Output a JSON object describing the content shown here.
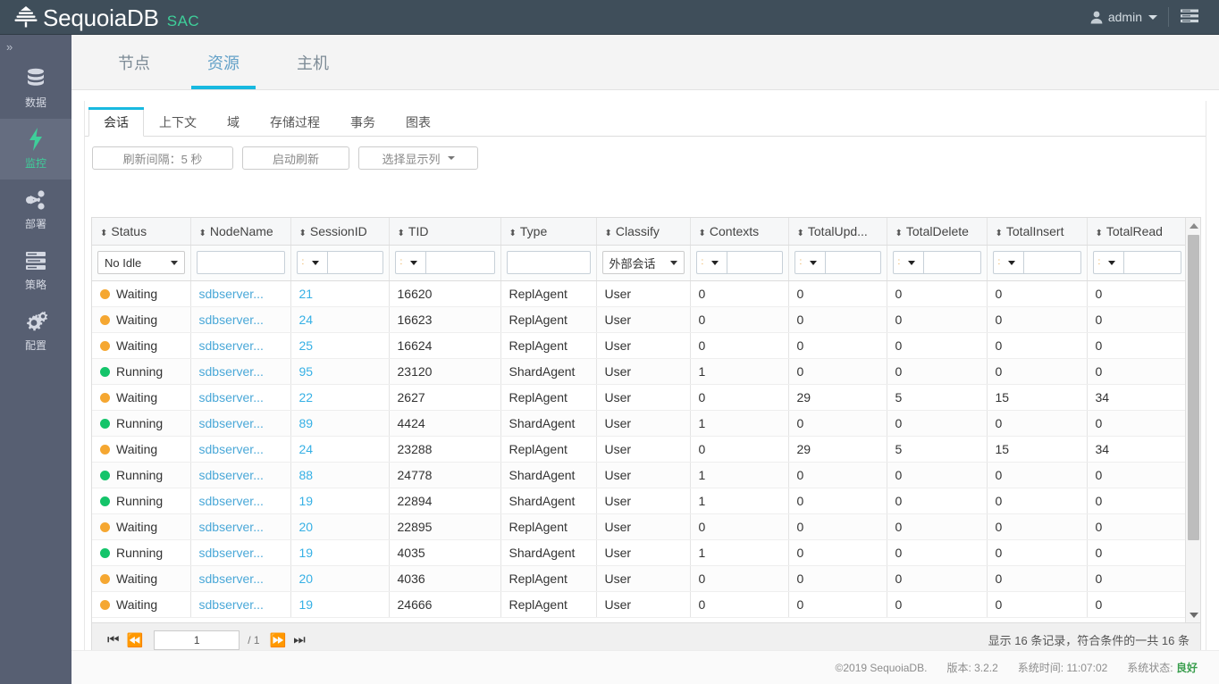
{
  "topbar": {
    "brand_name": "SequoiaDB",
    "brand_suffix": "SAC",
    "user": "admin"
  },
  "sidebar": {
    "items": [
      {
        "label": "数据",
        "icon": "database-icon",
        "active": false
      },
      {
        "label": "监控",
        "icon": "bolt-icon",
        "active": true
      },
      {
        "label": "部署",
        "icon": "share-icon",
        "active": false
      },
      {
        "label": "策略",
        "icon": "list-icon",
        "active": false
      },
      {
        "label": "配置",
        "icon": "gears-icon",
        "active": false
      }
    ]
  },
  "main_tabs": [
    {
      "label": "节点",
      "active": false
    },
    {
      "label": "资源",
      "active": true
    },
    {
      "label": "主机",
      "active": false
    }
  ],
  "sub_tabs": [
    {
      "label": "会话",
      "active": true
    },
    {
      "label": "上下文",
      "active": false
    },
    {
      "label": "域",
      "active": false
    },
    {
      "label": "存储过程",
      "active": false
    },
    {
      "label": "事务",
      "active": false
    },
    {
      "label": "图表",
      "active": false
    }
  ],
  "toolbar": {
    "refresh_interval": "刷新间隔：5 秒",
    "start_refresh": "启动刷新",
    "select_columns": "选择显示列"
  },
  "table": {
    "columns": [
      {
        "label": "Status",
        "filter": "select",
        "value": "No Idle"
      },
      {
        "label": "NodeName",
        "filter": "text",
        "value": ""
      },
      {
        "label": "SessionID",
        "filter": "combo",
        "value": ""
      },
      {
        "label": "TID",
        "filter": "combo",
        "value": ""
      },
      {
        "label": "Type",
        "filter": "text",
        "value": ""
      },
      {
        "label": "Classify",
        "filter": "select",
        "value": "外部会话"
      },
      {
        "label": "Contexts",
        "filter": "combo",
        "value": ""
      },
      {
        "label": "TotalUpd...",
        "filter": "combo",
        "value": ""
      },
      {
        "label": "TotalDelete",
        "filter": "combo",
        "value": ""
      },
      {
        "label": "TotalInsert",
        "filter": "combo",
        "value": ""
      },
      {
        "label": "TotalRead",
        "filter": "combo",
        "value": ""
      }
    ],
    "rows": [
      {
        "status": "Waiting",
        "status_color": "#f5a731",
        "node": "sdbserver...",
        "session": "21",
        "tid": "16620",
        "type": "ReplAgent",
        "classify": "User",
        "contexts": "0",
        "upd": "0",
        "del": "0",
        "ins": "0",
        "read": "0"
      },
      {
        "status": "Waiting",
        "status_color": "#f5a731",
        "node": "sdbserver...",
        "session": "24",
        "tid": "16623",
        "type": "ReplAgent",
        "classify": "User",
        "contexts": "0",
        "upd": "0",
        "del": "0",
        "ins": "0",
        "read": "0"
      },
      {
        "status": "Waiting",
        "status_color": "#f5a731",
        "node": "sdbserver...",
        "session": "25",
        "tid": "16624",
        "type": "ReplAgent",
        "classify": "User",
        "contexts": "0",
        "upd": "0",
        "del": "0",
        "ins": "0",
        "read": "0"
      },
      {
        "status": "Running",
        "status_color": "#14c46a",
        "node": "sdbserver...",
        "session": "95",
        "tid": "23120",
        "type": "ShardAgent",
        "classify": "User",
        "contexts": "1",
        "upd": "0",
        "del": "0",
        "ins": "0",
        "read": "0"
      },
      {
        "status": "Waiting",
        "status_color": "#f5a731",
        "node": "sdbserver...",
        "session": "22",
        "tid": "2627",
        "type": "ReplAgent",
        "classify": "User",
        "contexts": "0",
        "upd": "29",
        "del": "5",
        "ins": "15",
        "read": "34"
      },
      {
        "status": "Running",
        "status_color": "#14c46a",
        "node": "sdbserver...",
        "session": "89",
        "tid": "4424",
        "type": "ShardAgent",
        "classify": "User",
        "contexts": "1",
        "upd": "0",
        "del": "0",
        "ins": "0",
        "read": "0"
      },
      {
        "status": "Waiting",
        "status_color": "#f5a731",
        "node": "sdbserver...",
        "session": "24",
        "tid": "23288",
        "type": "ReplAgent",
        "classify": "User",
        "contexts": "0",
        "upd": "29",
        "del": "5",
        "ins": "15",
        "read": "34"
      },
      {
        "status": "Running",
        "status_color": "#14c46a",
        "node": "sdbserver...",
        "session": "88",
        "tid": "24778",
        "type": "ShardAgent",
        "classify": "User",
        "contexts": "1",
        "upd": "0",
        "del": "0",
        "ins": "0",
        "read": "0"
      },
      {
        "status": "Running",
        "status_color": "#14c46a",
        "node": "sdbserver...",
        "session": "19",
        "tid": "22894",
        "type": "ShardAgent",
        "classify": "User",
        "contexts": "1",
        "upd": "0",
        "del": "0",
        "ins": "0",
        "read": "0"
      },
      {
        "status": "Waiting",
        "status_color": "#f5a731",
        "node": "sdbserver...",
        "session": "20",
        "tid": "22895",
        "type": "ReplAgent",
        "classify": "User",
        "contexts": "0",
        "upd": "0",
        "del": "0",
        "ins": "0",
        "read": "0"
      },
      {
        "status": "Running",
        "status_color": "#14c46a",
        "node": "sdbserver...",
        "session": "19",
        "tid": "4035",
        "type": "ShardAgent",
        "classify": "User",
        "contexts": "1",
        "upd": "0",
        "del": "0",
        "ins": "0",
        "read": "0"
      },
      {
        "status": "Waiting",
        "status_color": "#f5a731",
        "node": "sdbserver...",
        "session": "20",
        "tid": "4036",
        "type": "ReplAgent",
        "classify": "User",
        "contexts": "0",
        "upd": "0",
        "del": "0",
        "ins": "0",
        "read": "0"
      },
      {
        "status": "Waiting",
        "status_color": "#f5a731",
        "node": "sdbserver...",
        "session": "19",
        "tid": "24666",
        "type": "ReplAgent",
        "classify": "User",
        "contexts": "0",
        "upd": "0",
        "del": "0",
        "ins": "0",
        "read": "0"
      }
    ]
  },
  "pager": {
    "page_value": "1",
    "page_total": "/ 1",
    "record_info": "显示 16 条记录，符合条件的一共 16 条"
  },
  "footer": {
    "copyright": "©2019 SequoiaDB.",
    "version": "版本: 3.2.2",
    "systime": "系统时间: 11:07:02",
    "status_label": "系统状态:",
    "status_value": "良好"
  },
  "colors": {
    "accent": "#18b9e0",
    "brand_green": "#3ecf9a",
    "waiting": "#f5a731",
    "running": "#14c46a",
    "topbar_bg": "#3f4e5a",
    "rail_bg": "#575f72"
  }
}
